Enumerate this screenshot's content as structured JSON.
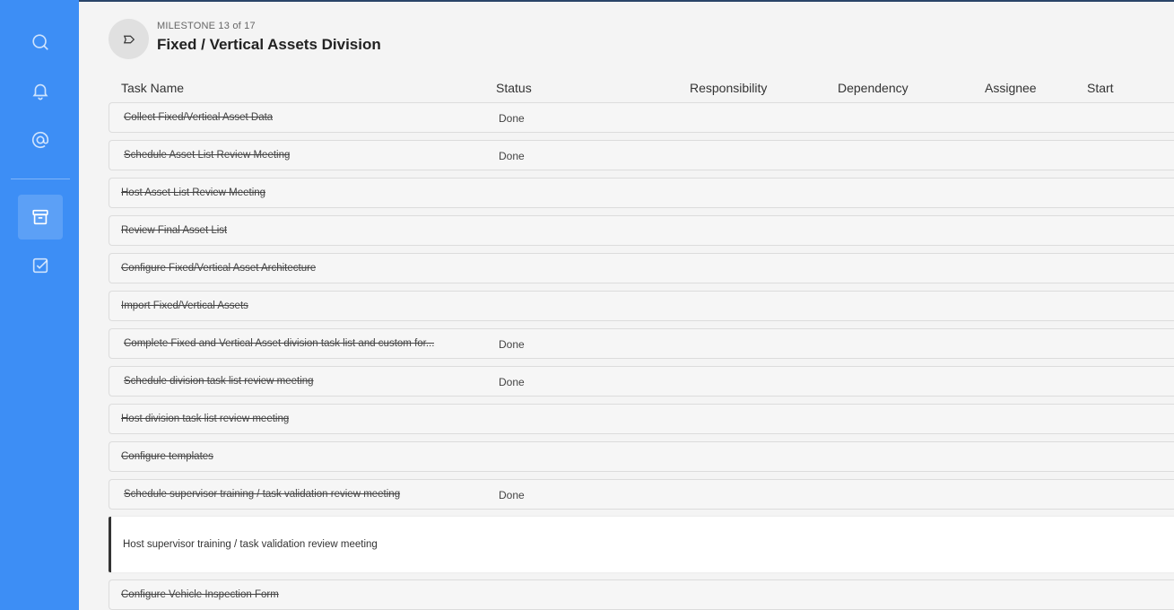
{
  "sidebar": {
    "items": [
      {
        "name": "search",
        "icon": "search-icon"
      },
      {
        "name": "notifications",
        "icon": "bell-icon"
      },
      {
        "name": "mentions",
        "icon": "at-icon"
      },
      {
        "name": "archive",
        "icon": "archive-icon"
      },
      {
        "name": "tasks",
        "icon": "checkbox-icon"
      }
    ],
    "active": "archive"
  },
  "milestone": {
    "kicker": "MILESTONE 13 of 17",
    "title": "Fixed / Vertical Assets Division",
    "icon": "milestone-tag-icon"
  },
  "columns": [
    "Task Name",
    "Status",
    "Responsibility",
    "Dependency",
    "Assignee",
    "Start"
  ],
  "tasks": [
    {
      "name": "Collect Fixed/Vertical Asset Data",
      "status": "Done",
      "completed": true,
      "indented": true
    },
    {
      "name": "Schedule Asset List Review Meeting",
      "status": "Done",
      "completed": true,
      "indented": true
    },
    {
      "name": "Host Asset List Review Meeting",
      "status": "",
      "completed": true,
      "indented": false
    },
    {
      "name": "Review Final Asset List",
      "status": "",
      "completed": true,
      "indented": false
    },
    {
      "name": "Configure Fixed/Vertical Asset Architecture",
      "status": "",
      "completed": true,
      "indented": false
    },
    {
      "name": "Import Fixed/Vertical Assets",
      "status": "",
      "completed": true,
      "indented": false
    },
    {
      "name": "Complete Fixed and Vertical Asset division task list and custom for...",
      "status": "Done",
      "completed": true,
      "indented": true
    },
    {
      "name": "Schedule division task list review meeting",
      "status": "Done",
      "completed": true,
      "indented": true
    },
    {
      "name": "Host division task list review meeting",
      "status": "",
      "completed": true,
      "indented": false
    },
    {
      "name": "Configure templates",
      "status": "",
      "completed": true,
      "indented": false
    },
    {
      "name": "Schedule supervisor training / task validation review meeting",
      "status": "Done",
      "completed": true,
      "indented": true
    },
    {
      "name": "Host supervisor training / task validation review meeting",
      "status": "",
      "completed": false,
      "indented": false,
      "selected": true
    },
    {
      "name": "Configure Vehicle Inspection Form",
      "status": "",
      "completed": true,
      "indented": false
    }
  ],
  "colors": {
    "rail": "#3d8ef5",
    "background": "#f4f4f4",
    "selected_accent": "#333333"
  }
}
